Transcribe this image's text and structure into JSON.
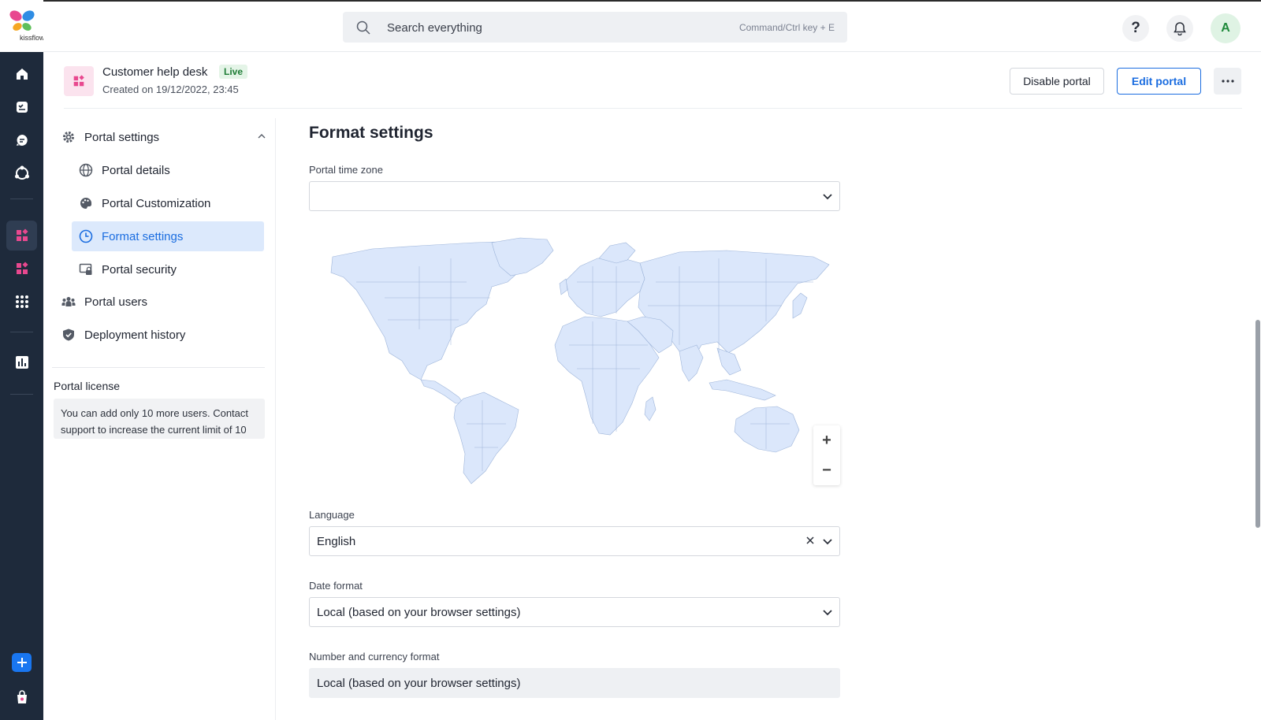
{
  "brand": {
    "logo_text": "kissflow"
  },
  "search": {
    "placeholder": "Search everything",
    "shortcut": "Command/Ctrl key + E"
  },
  "user": {
    "initial": "A"
  },
  "portal": {
    "title": "Customer help desk",
    "status": "Live",
    "created": "Created on 19/12/2022, 23:45",
    "disable_label": "Disable portal",
    "edit_label": "Edit portal"
  },
  "nav": {
    "section_label": "Portal settings",
    "items": [
      {
        "label": "Portal details",
        "icon": "globe-icon"
      },
      {
        "label": "Portal Customization",
        "icon": "palette-icon"
      },
      {
        "label": "Format settings",
        "icon": "clock-icon"
      },
      {
        "label": "Portal security",
        "icon": "lock-screen-icon"
      }
    ],
    "users_label": "Portal users",
    "history_label": "Deployment history",
    "license_title": "Portal license",
    "license_text": "You can add only 10 more users. Contact support to increase the current limit of 10"
  },
  "content": {
    "heading": "Format settings",
    "timezone_label": "Portal time zone",
    "timezone_value": "",
    "language_label": "Language",
    "language_value": "English",
    "date_label": "Date format",
    "date_value": "Local (based on your browser settings)",
    "number_label": "Number and currency format",
    "number_value": "Local (based on your browser settings)"
  },
  "colors": {
    "accent": "#1b6de0",
    "rail": "#1e2a3b",
    "map_fill": "#dbe7fb",
    "live": "#1e7c35"
  }
}
